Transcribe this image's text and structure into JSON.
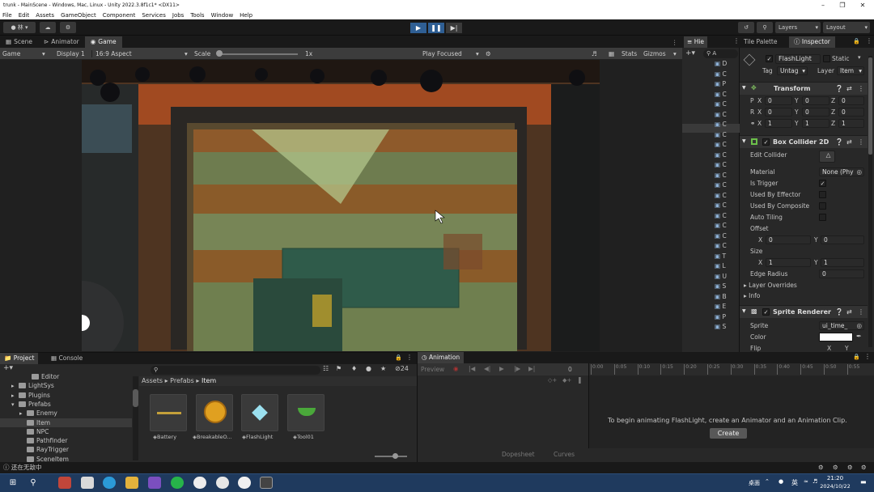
{
  "window": {
    "title": "trunk - MainScene - Windows, Mac, Linux - Unity 2022.3.8f1c1* <DX11>"
  },
  "menu": [
    "File",
    "Edit",
    "Assets",
    "GameObject",
    "Component",
    "Services",
    "Jobs",
    "Tools",
    "Window",
    "Help"
  ],
  "toolbar": {
    "account_label": "林 ▾",
    "layers_label": "Layers",
    "layout_label": "Layout"
  },
  "scene_tabs": [
    "Scene",
    "Animator",
    "Game"
  ],
  "game_bar": {
    "mode": "Game",
    "display": "Display 1",
    "aspect": "16:9 Aspect",
    "scale_label": "Scale",
    "scale_value": "1x",
    "play_mode": "Play Focused",
    "stats": "Stats",
    "gizmos": "Gizmos"
  },
  "hierarchy": {
    "title": "Hie",
    "search": "A",
    "rows": [
      "D",
      "C",
      "P",
      "C",
      "C",
      "C",
      "C",
      "C",
      "C",
      "C",
      "C",
      "C",
      "C",
      "C",
      "C",
      "C",
      "C",
      "C",
      "C",
      "T",
      "L",
      "U",
      "S",
      "B",
      "E",
      "P",
      "S"
    ]
  },
  "inspector_tabs": [
    "Tile Palette",
    "Inspector"
  ],
  "object": {
    "name": "FlashLight",
    "static_label": "Static",
    "tag_label": "Tag",
    "tag_value": "Untag",
    "layer_label": "Layer",
    "layer_value": "Item"
  },
  "transform": {
    "title": "Transform",
    "rows": [
      {
        "label": "P",
        "x": "0",
        "y": "0",
        "z": "0"
      },
      {
        "label": "R",
        "x": "0",
        "y": "0",
        "z": "0"
      },
      {
        "label": "",
        "x": "1",
        "y": "1",
        "z": "1"
      }
    ]
  },
  "box_collider": {
    "title": "Box Collider 2D",
    "edit_collider": "Edit Collider",
    "material_label": "Material",
    "material_value": "None (Phy",
    "is_trigger": "Is Trigger",
    "used_by_effector": "Used By Effector",
    "used_by_composite": "Used By Composite",
    "auto_tiling": "Auto Tiling",
    "offset_label": "Offset",
    "offset_x": "0",
    "offset_y": "0",
    "size_label": "Size",
    "size_x": "1",
    "size_y": "1",
    "edge_radius_label": "Edge Radius",
    "edge_radius": "0",
    "layer_overrides": "Layer Overrides",
    "info": "Info"
  },
  "sprite_renderer": {
    "title": "Sprite Renderer",
    "sprite_label": "Sprite",
    "sprite_value": "ui_time_",
    "color_label": "Color",
    "flip_label": "Flip",
    "flip_x": "X",
    "flip_y": "Y"
  },
  "project": {
    "tabs": [
      "Project",
      "Console"
    ],
    "tree": [
      "Editor",
      "LightSys",
      "Plugins",
      "Prefabs",
      "Enemy",
      "Item",
      "NPC",
      "Pathfinder",
      "RayTrigger",
      "SceneItem"
    ],
    "breadcrumb": [
      "Assets",
      "Prefabs",
      "Item"
    ],
    "count": "24",
    "assets": [
      "Battery",
      "BreakableO...",
      "FlashLight",
      "Tool01"
    ]
  },
  "animation": {
    "tab": "Animation",
    "preview": "Preview",
    "frame": "0",
    "ticks": [
      "0:00",
      "0:05",
      "0:10",
      "0:15",
      "0:20",
      "0:25",
      "0:30",
      "0:35",
      "0:40",
      "0:45",
      "0:50",
      "0:55"
    ],
    "message": "To begin animating FlashLight, create an Animator and an Animation Clip.",
    "create": "Create",
    "dopesheet": "Dopesheet",
    "curves": "Curves"
  },
  "status": {
    "text": "还在无敌中"
  },
  "taskbar": {
    "lang": "英",
    "desktop": "桌面",
    "time": "21:20",
    "date": "2024/10/22"
  }
}
